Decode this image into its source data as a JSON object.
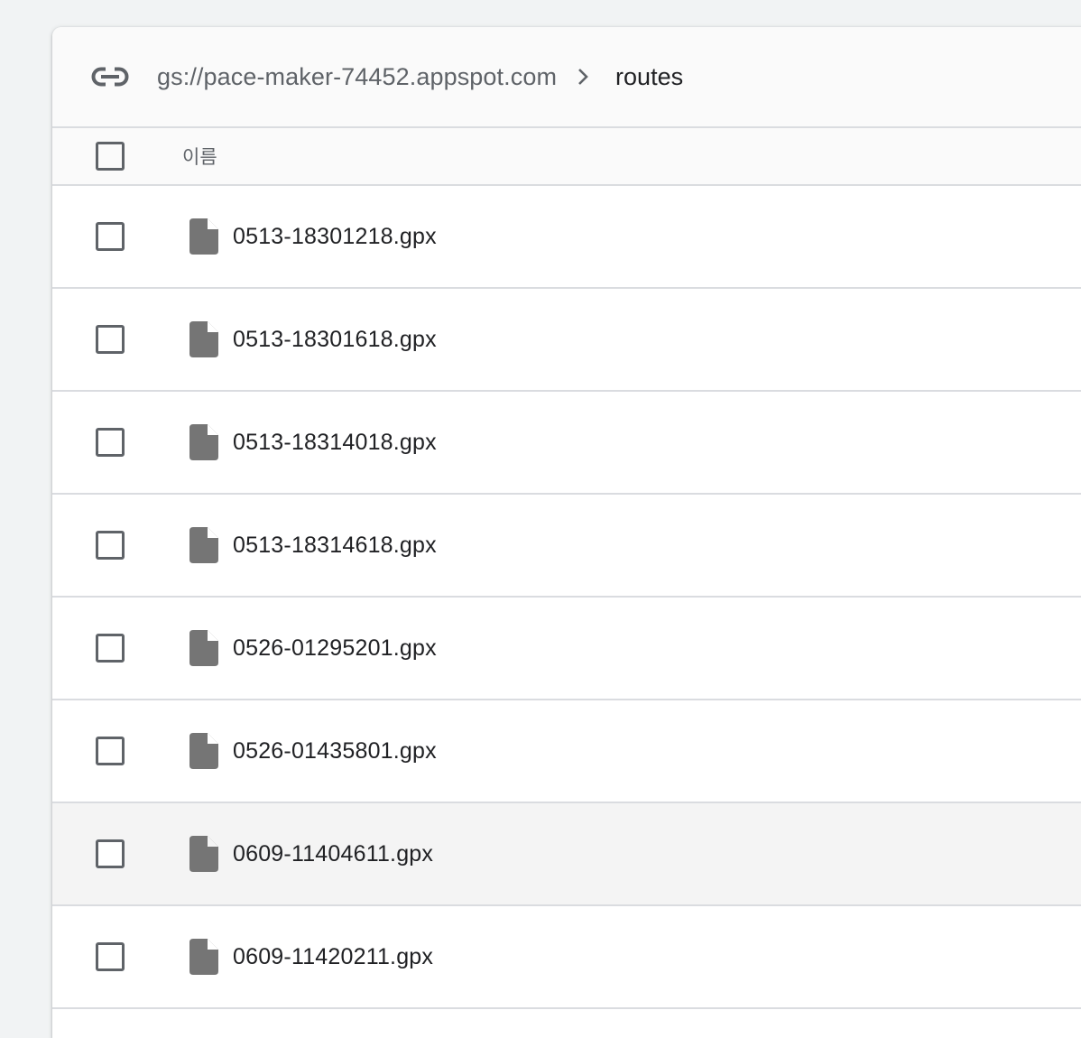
{
  "breadcrumb": {
    "link_icon": "link-icon",
    "bucket": "gs://pace-maker-74452.appspot.com",
    "separator_icon": "chevron-right-icon",
    "current_folder": "routes"
  },
  "table": {
    "header": {
      "name_label": "이름"
    },
    "file_icon": "file-icon",
    "rows": [
      {
        "name": "0513-18301218.gpx"
      },
      {
        "name": "0513-18301618.gpx"
      },
      {
        "name": "0513-18314018.gpx"
      },
      {
        "name": "0513-18314618.gpx"
      },
      {
        "name": "0526-01295201.gpx"
      },
      {
        "name": "0526-01435801.gpx"
      },
      {
        "name": "0609-11404611.gpx"
      },
      {
        "name": "0609-11420211.gpx"
      }
    ]
  },
  "colors": {
    "page_background": "#f1f3f4",
    "text_primary": "#202124",
    "text_secondary": "#5f6368",
    "icon": "#757575",
    "divider": "#dadce0",
    "row_hover": "#f4f4f4"
  }
}
